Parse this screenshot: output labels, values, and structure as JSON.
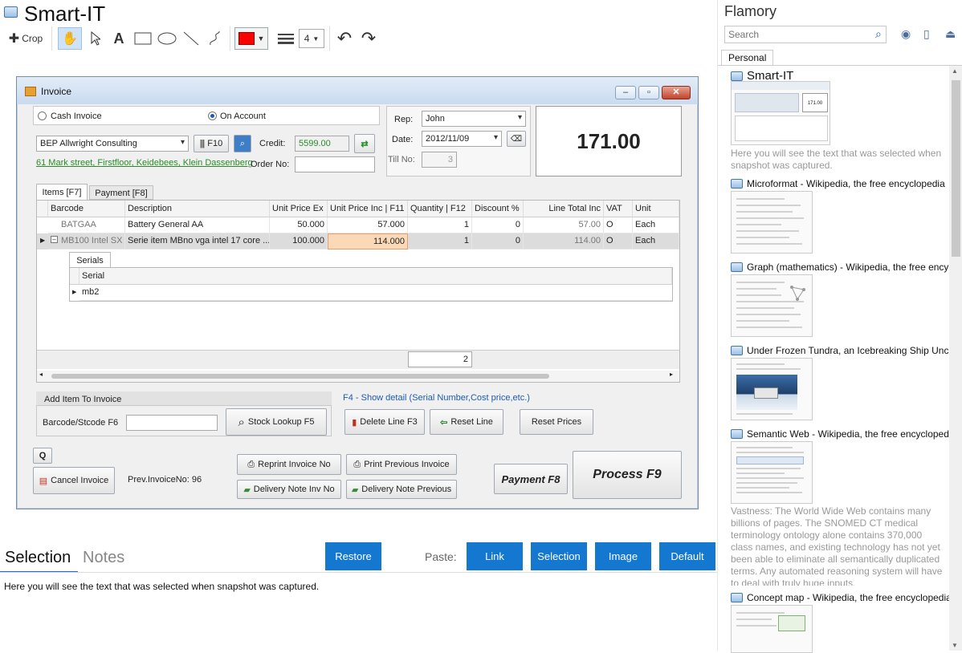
{
  "app": {
    "title": "Smart-IT"
  },
  "toolbar": {
    "crop_label": "Crop",
    "text_tool": "A",
    "line_width_value": "4"
  },
  "invoice_window": {
    "title": "Invoice",
    "cash_invoice": "Cash Invoice",
    "on_account": "On Account",
    "customer": "BEP Allwright Consulting",
    "f10": "F10",
    "credit_label": "Credit:",
    "credit_value": "5599.00",
    "address": "61 Mark street, Firstfloor, Keidebees, Klein Dassenberg",
    "order_no_label": "Order No:",
    "rep_label": "Rep:",
    "rep_value": "John",
    "date_label": "Date:",
    "date_value": "2012/11/09",
    "till_label": "Till No:",
    "till_value": "3",
    "total": "171.00",
    "tabs": [
      "Items [F7]",
      "Payment [F8]"
    ],
    "columns": [
      "Barcode",
      "Description",
      "Unit Price Ex",
      "Unit Price Inc | F11",
      "Quantity | F12",
      "Discount %",
      "Line Total Inc",
      "VAT",
      "Unit"
    ],
    "rows": [
      [
        "BATGAA",
        "Battery General AA",
        "50.000",
        "57.000",
        "1",
        "0",
        "57.00",
        "O",
        "Each"
      ],
      [
        "MB100 Intel SX",
        "Serie item MBno vga  intel 17 core ...",
        "100.000",
        "114.000",
        "1",
        "0",
        "114.00",
        "O",
        "Each"
      ]
    ],
    "serials_tab": "Serials",
    "serial_header": "Serial",
    "serial_value": "mb2",
    "quantity_total": "2",
    "add_item_title": "Add Item To Invoice",
    "barcode_label": "Barcode/Stcode F6",
    "stock_lookup": "Stock Lookup F5",
    "f4_hint": "F4 - Show detail (Serial Number,Cost price,etc.)",
    "delete_line": "Delete Line F3",
    "reset_line": "Reset Line",
    "reset_prices": "Reset Prices",
    "q_button": "Q",
    "cancel_invoice": "Cancel Invoice",
    "prev_invoice": "Prev.InvoiceNo: 96",
    "reprint": "Reprint Invoice No",
    "print_previous": "Print Previous Invoice",
    "delivery_note_inv": "Delivery Note Inv No",
    "delivery_note_prev": "Delivery Note Previous",
    "payment": "Payment F8",
    "process": "Process F9"
  },
  "bottom": {
    "tab_selection": "Selection",
    "tab_notes": "Notes",
    "restore": "Restore",
    "paste_label": "Paste:",
    "paste_buttons": [
      "Link",
      "Selection",
      "Image",
      "Default"
    ],
    "selection_text": "Here you will see the text that was selected when snapshot was captured."
  },
  "sidebar": {
    "title": "Flamory",
    "search_placeholder": "Search",
    "tab": "Personal",
    "items": [
      {
        "title": "Smart-IT",
        "caption": "Here you will see the text that was selected when snapshot was captured."
      },
      {
        "title": "Microformat - Wikipedia, the free encyclopedia"
      },
      {
        "title": "Graph (mathematics) - Wikipedia, the free encyclopedia"
      },
      {
        "title": "Under Frozen Tundra, an Icebreaking Ship Uncovers..."
      },
      {
        "title": "Semantic Web - Wikipedia, the free encyclopedia",
        "caption": "Vastness: The World Wide Web contains many billions of pages. The SNOMED CT medical terminology ontology alone contains 370,000 class names, and existing technology has not yet been able to eliminate all semantically duplicated terms. Any automated reasoning system will have to deal with truly huge inputs."
      },
      {
        "title": "Concept map - Wikipedia, the free encyclopedia"
      }
    ]
  }
}
